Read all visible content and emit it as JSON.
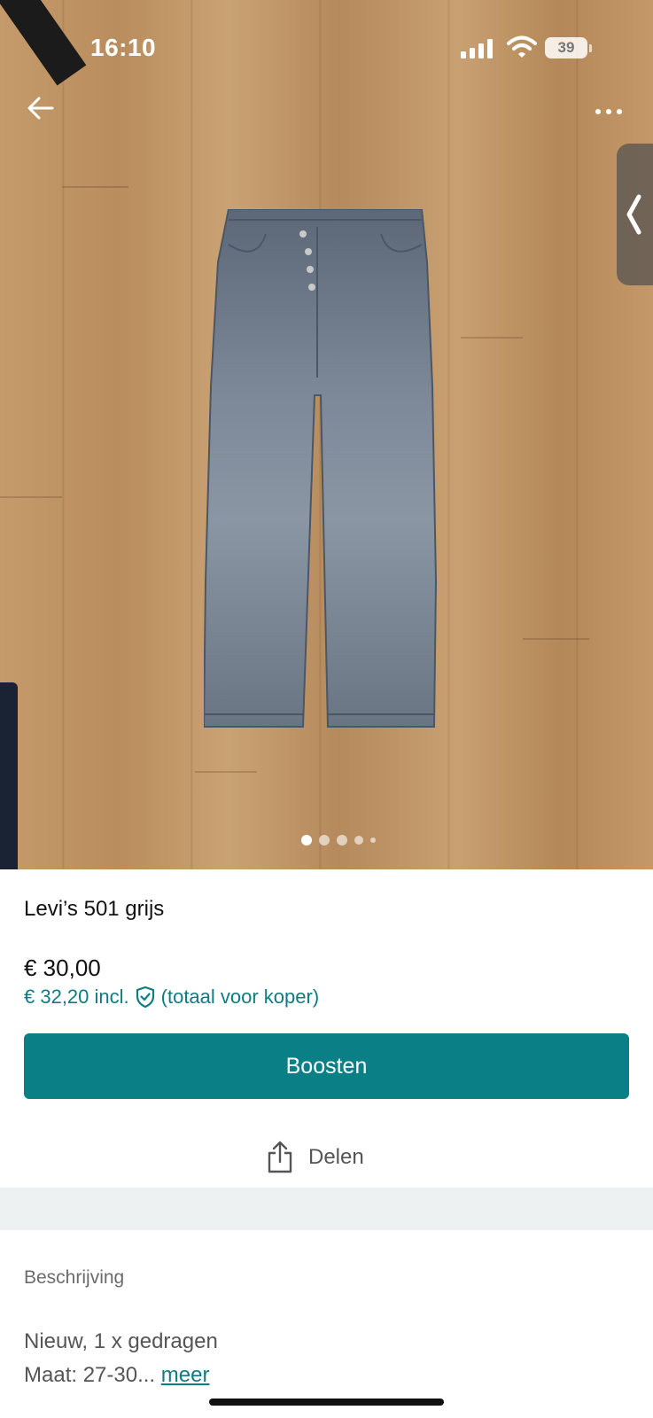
{
  "status_bar": {
    "time": "16:10",
    "battery": "39"
  },
  "icons": {
    "back": "arrow-left-icon",
    "more": "ellipsis-icon",
    "side_panel": "chevron-left-icon",
    "shield": "shield-check-icon",
    "share": "share-icon"
  },
  "gallery": {
    "image_count": 5,
    "active_index": 0
  },
  "item": {
    "title": "Levi’s 501 grijs",
    "price": "€ 30,00",
    "price_incl": "€ 32,20 incl.",
    "price_incl_note": "(totaal voor koper)"
  },
  "actions": {
    "boost_label": "Boosten",
    "share_label": "Delen"
  },
  "description": {
    "heading": "Beschrijving",
    "line1": "Nieuw, 1 x gedragen",
    "line2": "Maat: 27-30...",
    "more_label": "meer"
  },
  "colors": {
    "accent": "#0b7f86",
    "accent_text": "#0f7b82",
    "divider": "#eef1f2"
  }
}
